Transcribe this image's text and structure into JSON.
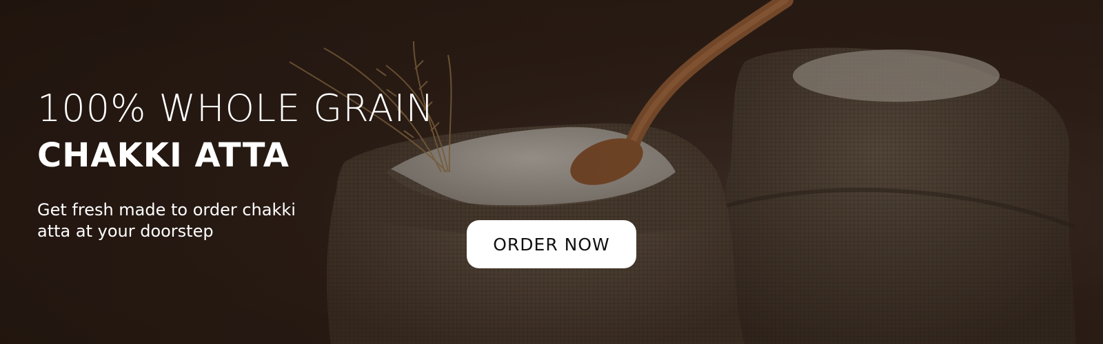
{
  "hero": {
    "headline_line1": "100% WHOLE GRAIN",
    "headline_line2": "CHAKKI ATTA",
    "subtitle_line1": "Get fresh made to order chakki",
    "subtitle_line2": "atta at your doorstep",
    "cta_label": "ORDER NOW",
    "background_image": "flour-in-burlap-sacks-with-wooden-spoon-and-wheat",
    "colors": {
      "background": "#2a1c15",
      "text": "#ffffff",
      "button_bg": "#ffffff",
      "button_text": "#111111"
    }
  }
}
